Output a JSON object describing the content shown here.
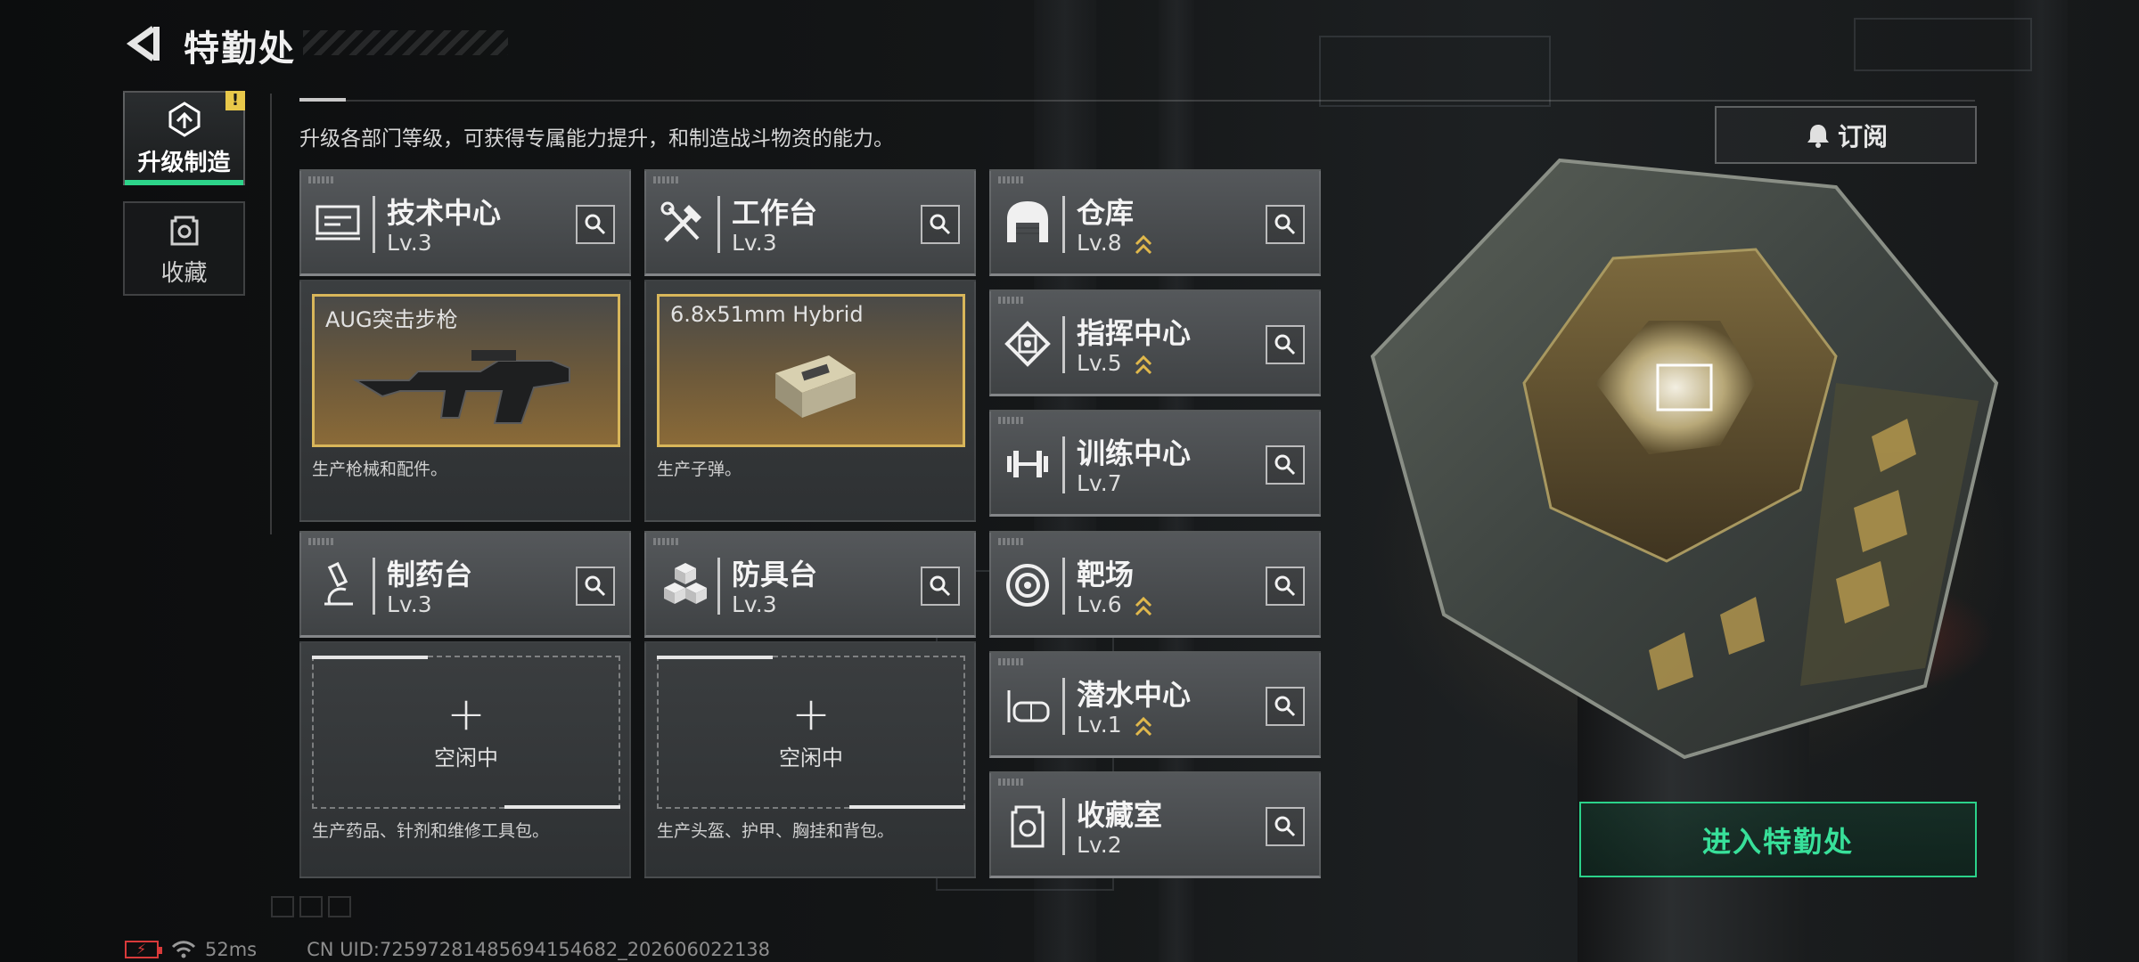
{
  "header": {
    "title": "特勤处"
  },
  "tabs": [
    {
      "label": "升级制造",
      "active": true,
      "alert": "!"
    },
    {
      "label": "收藏",
      "active": false
    }
  ],
  "description": "升级各部门等级，可获得专属能力提升，和制造战斗物资的能力。",
  "subscribe_label": "订阅",
  "facilities": {
    "tech": {
      "name": "技术中心",
      "level": "Lv.3"
    },
    "workbench": {
      "name": "工作台",
      "level": "Lv.3"
    },
    "pharmacy": {
      "name": "制药台",
      "level": "Lv.3"
    },
    "armor": {
      "name": "防具台",
      "level": "Lv.3"
    },
    "warehouse": {
      "name": "仓库",
      "level": "Lv.8"
    },
    "command": {
      "name": "指挥中心",
      "level": "Lv.5"
    },
    "training": {
      "name": "训练中心",
      "level": "Lv.7"
    },
    "range": {
      "name": "靶场",
      "level": "Lv.6"
    },
    "diving": {
      "name": "潜水中心",
      "level": "Lv.1"
    },
    "collection": {
      "name": "收藏室",
      "level": "Lv.2"
    }
  },
  "production": {
    "tech": {
      "item": "AUG突击步枪",
      "caption": "生产枪械和配件。"
    },
    "workbench": {
      "item": "6.8x51mm Hybrid",
      "caption": "生产子弹。"
    },
    "pharmacy": {
      "idle_label": "空闲中",
      "caption": "生产药品、针剂和维修工具包。"
    },
    "armor": {
      "idle_label": "空闲中",
      "caption": "生产头盔、护甲、胸挂和背包。"
    }
  },
  "enter_button": "进入特勤处",
  "status": {
    "ping": "52ms",
    "uid": "CN UID:7259728148569415468​2_202606022138"
  },
  "colors": {
    "accent_green": "#2bd28a",
    "upgrade_gold": "#e0b84c",
    "slot_border": "#d8b65a",
    "battery_red": "#d83a3a"
  },
  "icons": [
    "back-arrow-icon",
    "upgrade-icon",
    "collection-icon",
    "alert-icon",
    "bell-icon",
    "search-icon",
    "upgrade-chevron-icon",
    "wifi-icon",
    "battery-icon"
  ]
}
